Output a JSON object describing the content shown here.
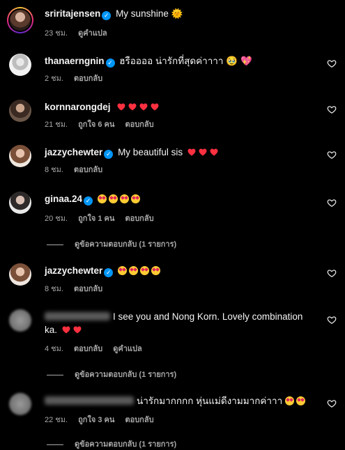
{
  "comments": [
    {
      "user": "sriritajensen",
      "text": "My sunshine",
      "emoji": "🌞",
      "time": "23 ชม.",
      "action2": "ดูคำแปล"
    },
    {
      "user": "thanaerngnin",
      "text": "ฮรืออออ น่ารักที่สุดค่าาาา",
      "emoji": "🥹 💖",
      "time": "2 ชม.",
      "reply": "ตอบกลับ"
    },
    {
      "user": "kornnarongdej",
      "hearts": 4,
      "time": "21 ชม.",
      "likes": "ถูกใจ 6 คน",
      "reply": "ตอบกลับ"
    },
    {
      "user": "jazzychewter",
      "text": "My beautiful sis",
      "hearts": 3,
      "time": "8 ชม.",
      "reply": "ตอบกลับ"
    },
    {
      "user": "ginaa.24",
      "stareyes": 4,
      "time": "20 ชม.",
      "likes": "ถูกใจ 1 คน",
      "reply": "ตอบกลับ",
      "view_replies": "ดูข้อความตอบกลับ (1 รายการ)"
    },
    {
      "user": "jazzychewter",
      "stareyes": 4,
      "time": "8 ชม.",
      "reply": "ตอบกลับ"
    },
    {
      "text_line1": "I see you and Nong Korn. Lovely combination",
      "text_line2": "ka.",
      "hearts": 2,
      "time": "4 ชม.",
      "reply": "ตอบกลับ",
      "translate": "ดูคำแปล",
      "view_replies": "ดูข้อความตอบกลับ (1 รายการ)"
    },
    {
      "text": "น่ารักมากกกก หุ่นแม่ดีงามมากค่าาา",
      "stareyes": 2,
      "time": "22 ชม.",
      "likes": "ถูกใจ 3 คน",
      "reply": "ตอบกลับ",
      "view_replies": "ดูข้อความตอบกลับ (1 รายการ)"
    }
  ],
  "verified_mark": "✓",
  "heart_icon": "heart-outline-icon",
  "colors": {
    "background": "#000000",
    "verified": "#0095f6",
    "muted": "#a8a8a8",
    "heart": "#ff3040"
  }
}
